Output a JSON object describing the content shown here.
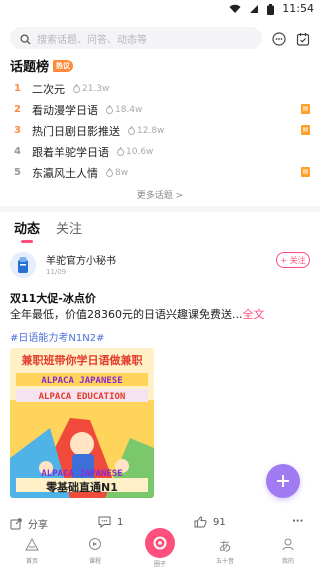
{
  "status_bar": {
    "time": "11:54"
  },
  "search": {
    "placeholder": "搜索话题、问答、动态等"
  },
  "hot_topics": {
    "title": "话题榜",
    "badge": "热议",
    "items": [
      {
        "rank": "1",
        "name": "二次元",
        "heat": "21.3w",
        "rank_color": "#ff8a3d",
        "has_tag": false
      },
      {
        "rank": "2",
        "name": "看动漫学日语",
        "heat": "18.4w",
        "rank_color": "#ff8a3d",
        "has_tag": true
      },
      {
        "rank": "3",
        "name": "热门日剧日影推送",
        "heat": "12.8w",
        "rank_color": "#ff8a3d",
        "has_tag": true
      },
      {
        "rank": "4",
        "name": "跟着羊驼学日语",
        "heat": "10.6w",
        "rank_color": "#999999",
        "has_tag": false
      },
      {
        "rank": "5",
        "name": "东瀛风土人情",
        "heat": "8w",
        "rank_color": "#999999",
        "has_tag": true
      }
    ],
    "more": "更多话题 >"
  },
  "tabs": [
    {
      "label": "动态",
      "active": true
    },
    {
      "label": "关注",
      "active": false
    }
  ],
  "post": {
    "author": "羊驼官方小秘书",
    "date": "11/09",
    "follow": "+ 关注",
    "title": "双11大促-冰点价",
    "body": "全年最低，价值28360元的日语兴趣课免费送...",
    "more": "全文",
    "hashtag": "#日语能力考N1N2#",
    "image_text": {
      "line1": "兼职班带你学日语做兼职",
      "line2": "ALPACA JAPANESE",
      "line3": "ALPACA EDUCATION",
      "line4": "ALPACA JAPANESE",
      "line5": "零基础直通N1"
    }
  },
  "actions": {
    "share": "分享",
    "comments": "1",
    "likes": "91",
    "more": "···"
  },
  "bottom_nav": [
    {
      "label": "首页"
    },
    {
      "label": "课程"
    },
    {
      "label": "圈子"
    },
    {
      "label": "五十音"
    },
    {
      "label": "我的"
    }
  ],
  "colors": {
    "accent": "#ff4f7d",
    "fab": "#a07bf2",
    "hot": "#ff8a3d",
    "link": "#4b6fd6"
  }
}
